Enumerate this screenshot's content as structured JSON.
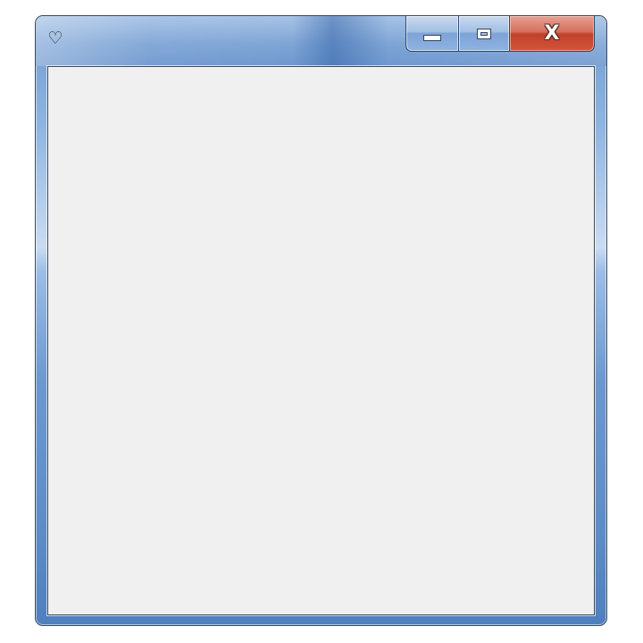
{
  "window": {
    "app_icon": "heart-icon",
    "app_icon_glyph": "♡",
    "title": ""
  },
  "caption_buttons": {
    "minimize_icon": "minimize-icon",
    "maximize_icon": "maximize-icon",
    "close_icon": "close-icon",
    "close_glyph": "X"
  },
  "colors": {
    "frame_blue": "#6f98cf",
    "close_red": "#c0412a",
    "client_background": "#f0f0f0"
  }
}
